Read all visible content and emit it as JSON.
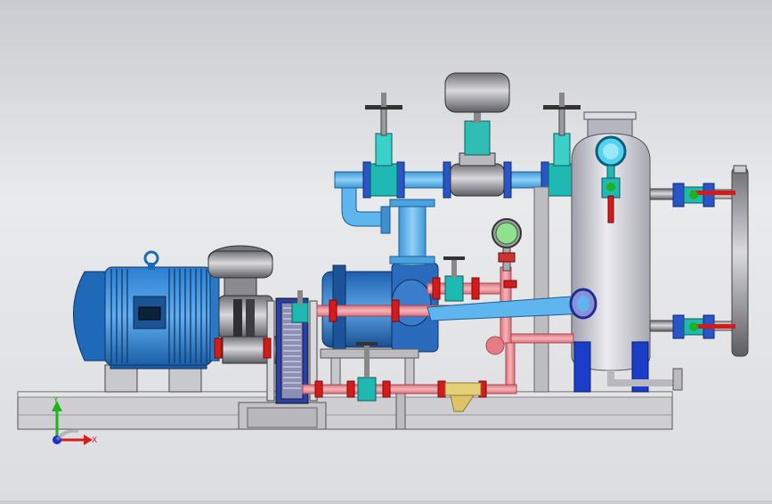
{
  "view": {
    "background_top": "#c9ccd0",
    "background_bottom": "#e9eaec"
  },
  "triad": {
    "x_label": "X",
    "y_label": "Y",
    "x_color": "#d61e1e",
    "y_color": "#1db31d",
    "z_color": "#1a2fd6"
  },
  "motor": {
    "nameplate": "",
    "color": "#1f73c6"
  },
  "palette": {
    "pipe_blue": "#5fb6ee",
    "pipe_pink": "#ee8f96",
    "valve_red": "#d41a1a",
    "valve_teal": "#1fb8b2",
    "vessel_grey": "#c9c9d2",
    "support_blue": "#1b3ec8",
    "frame_grey": "#c8c8cc",
    "strainer_yellow": "#e5d07a"
  },
  "components": [
    "electric-motor",
    "coupling-guard",
    "plate-heat-exchanger",
    "liquid-ring-vacuum-pump",
    "separator-tank",
    "level-gauge",
    "pressure-gauge",
    "y-strainer",
    "gate-valves",
    "actuated-control-valve",
    "base-frame"
  ]
}
